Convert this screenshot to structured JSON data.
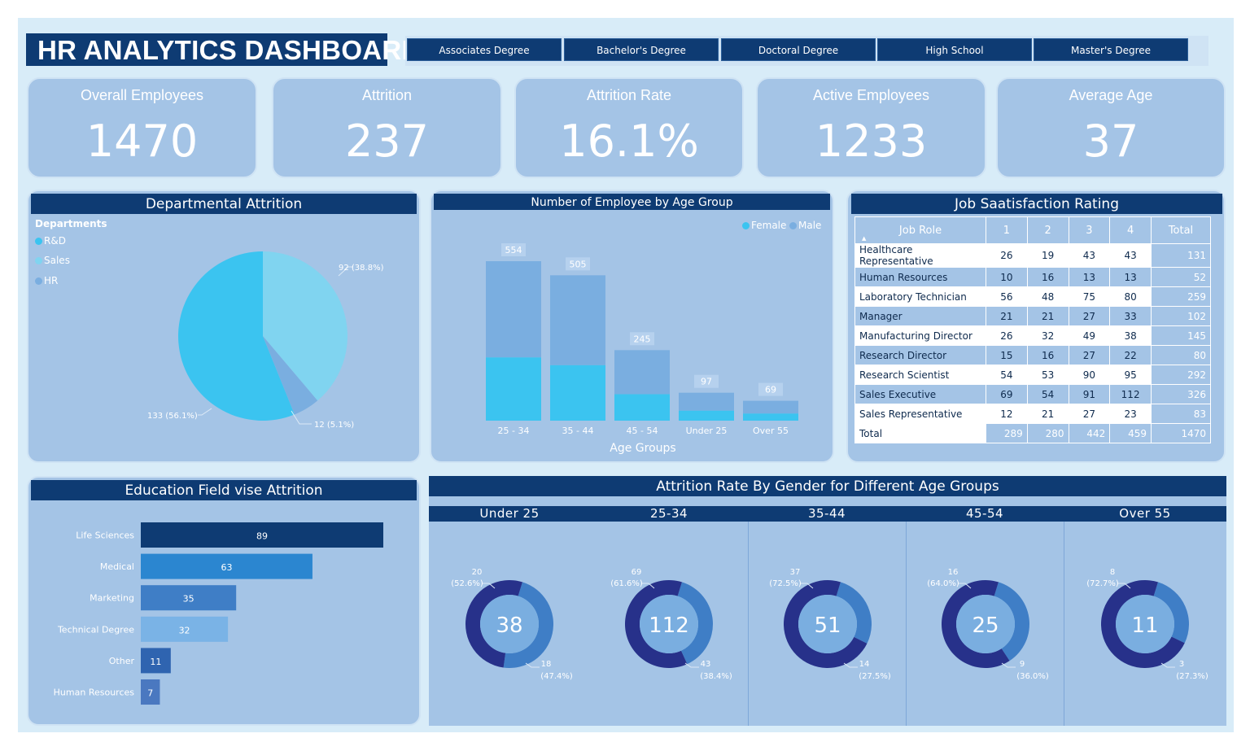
{
  "title": "HR ANALYTICS DASHBOARD",
  "slicers": [
    "Associates Degree",
    "Bachelor's Degree",
    "Doctoral Degree",
    "High School",
    "Master's Degree"
  ],
  "kpis": [
    {
      "label": "Overall Employees",
      "value": "1470"
    },
    {
      "label": "Attrition",
      "value": "237"
    },
    {
      "label": "Attrition Rate",
      "value": "16.1%"
    },
    {
      "label": "Active Employees",
      "value": "1233"
    },
    {
      "label": "Average Age",
      "value": "37"
    }
  ],
  "dept": {
    "title": "Departmental Attrition",
    "legend_title": "Departments",
    "legend": [
      "R&D",
      "Sales",
      "HR"
    ],
    "labels": [
      "133 (56.1%)",
      "92 (38.8%)",
      "12 (5.1%)"
    ]
  },
  "age": {
    "title": "Number of Employee by Age Group",
    "legend": [
      "Female",
      "Male"
    ],
    "xlabel": "Age Groups",
    "totals": [
      "554",
      "505",
      "245",
      "97",
      "69"
    ]
  },
  "jobsat": {
    "title": "Job Saatisfaction Rating",
    "headers": [
      "Job Role",
      "1",
      "2",
      "3",
      "4",
      "Total"
    ],
    "rows": [
      [
        "Healthcare Representative",
        "26",
        "19",
        "43",
        "43",
        "131"
      ],
      [
        "Human Resources",
        "10",
        "16",
        "13",
        "13",
        "52"
      ],
      [
        "Laboratory Technician",
        "56",
        "48",
        "75",
        "80",
        "259"
      ],
      [
        "Manager",
        "21",
        "21",
        "27",
        "33",
        "102"
      ],
      [
        "Manufacturing Director",
        "26",
        "32",
        "49",
        "38",
        "145"
      ],
      [
        "Research Director",
        "15",
        "16",
        "27",
        "22",
        "80"
      ],
      [
        "Research Scientist",
        "54",
        "53",
        "90",
        "95",
        "292"
      ],
      [
        "Sales Executive",
        "69",
        "54",
        "91",
        "112",
        "326"
      ],
      [
        "Sales Representative",
        "12",
        "21",
        "27",
        "23",
        "83"
      ]
    ],
    "total": [
      "Total",
      "289",
      "280",
      "442",
      "459",
      "1470"
    ]
  },
  "edu": {
    "title": "Education Field vise Attrition"
  },
  "gender": {
    "title": "Attrition Rate By Gender for Different Age Groups",
    "groups": [
      {
        "name": "Under 25",
        "center": "38",
        "top": "20",
        "top_pct": "(52.6%)",
        "bottom": "18",
        "bottom_pct": "(47.4%)",
        "top_share": 0.526
      },
      {
        "name": "25-34",
        "center": "112",
        "top": "69",
        "top_pct": "(61.6%)",
        "bottom": "43",
        "bottom_pct": "(38.4%)",
        "top_share": 0.616
      },
      {
        "name": "35-44",
        "center": "51",
        "top": "37",
        "top_pct": "(72.5%)",
        "bottom": "14",
        "bottom_pct": "(27.5%)",
        "top_share": 0.725
      },
      {
        "name": "45-54",
        "center": "25",
        "top": "16",
        "top_pct": "(64.0%)",
        "bottom": "9",
        "bottom_pct": "(36.0%)",
        "top_share": 0.64
      },
      {
        "name": "Over 55",
        "center": "11",
        "top": "8",
        "top_pct": "(72.7%)",
        "bottom": "3",
        "bottom_pct": "(27.3%)",
        "top_share": 0.727
      }
    ]
  },
  "colors": {
    "navy": "#0e3b73",
    "panel": "#a4c4e6",
    "cyan": "#3bc4f0",
    "light_cyan": "#80d4f0",
    "mid_blue": "#7aaee0",
    "ring_dark": "#27318a",
    "ring_light": "#3f7ec6"
  },
  "chart_data": [
    {
      "type": "pie",
      "title": "Departmental Attrition",
      "categories": [
        "R&D",
        "Sales",
        "HR"
      ],
      "values": [
        133,
        92,
        12
      ],
      "percentages": [
        56.1,
        38.8,
        5.1
      ],
      "legend": "top-left"
    },
    {
      "type": "bar",
      "title": "Number of Employee by Age Group",
      "categories": [
        "25 - 34",
        "35 - 44",
        "45 - 54",
        "Under 25",
        "Over 55"
      ],
      "xlabel": "Age Groups",
      "series": [
        {
          "name": "Female",
          "values": [
            220,
            193,
            92,
            35,
            25
          ]
        },
        {
          "name": "Male",
          "values": [
            334,
            312,
            153,
            62,
            44
          ]
        }
      ],
      "totals": [
        554,
        505,
        245,
        97,
        69
      ],
      "stacked": true,
      "legend": "top-right"
    },
    {
      "type": "bar",
      "orientation": "horizontal",
      "title": "Education Field vise Attrition",
      "categories": [
        "Life Sciences",
        "Medical",
        "Marketing",
        "Technical Degree",
        "Other",
        "Human Resources"
      ],
      "values": [
        89,
        63,
        35,
        32,
        11,
        7
      ],
      "colors": [
        "#0e3b73",
        "#2b86d0",
        "#3f7ec6",
        "#7ab3e6",
        "#2f64b0",
        "#4a78c0"
      ]
    },
    {
      "type": "pie",
      "subtype": "donut",
      "title": "Attrition Rate By Gender for Different Age Groups",
      "groups": [
        "Under 25",
        "25-34",
        "35-44",
        "45-54",
        "Over 55"
      ],
      "totals": [
        38,
        112,
        51,
        25,
        11
      ],
      "series": [
        {
          "values": [
            20,
            69,
            37,
            16,
            8
          ],
          "percentages": [
            52.6,
            61.6,
            72.5,
            64.0,
            72.7
          ]
        },
        {
          "values": [
            18,
            43,
            14,
            9,
            3
          ],
          "percentages": [
            47.4,
            38.4,
            27.5,
            36.0,
            27.3
          ]
        }
      ]
    }
  ]
}
